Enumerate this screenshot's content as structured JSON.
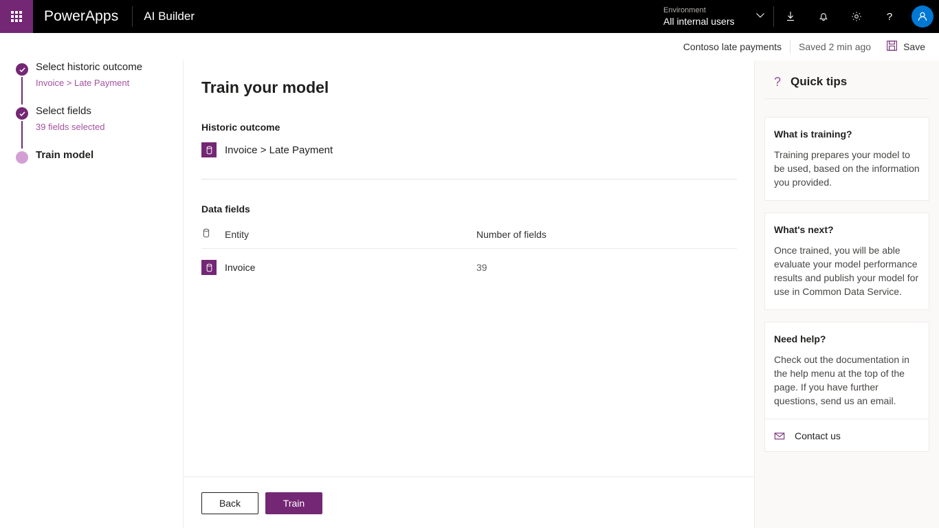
{
  "header": {
    "waffle_label": "app-launcher",
    "brand": "PowerApps",
    "app_name": "AI Builder",
    "environment_label": "Environment",
    "environment_value": "All internal users",
    "icons": [
      "download-icon",
      "bell-icon",
      "gear-icon",
      "help-icon",
      "avatar"
    ]
  },
  "command_bar": {
    "model_name": "Contoso late payments",
    "saved_status": "Saved 2 min ago",
    "save_label": "Save"
  },
  "wizard": {
    "steps": [
      {
        "title": "Select historic outcome",
        "sub": "Invoice > Late Payment",
        "state": "done"
      },
      {
        "title": "Select fields",
        "sub": "39 fields selected",
        "state": "done"
      },
      {
        "title": "Train model",
        "sub": "",
        "state": "current"
      }
    ]
  },
  "main": {
    "page_title": "Train your model",
    "historic_outcome_label": "Historic outcome",
    "historic_outcome_value": "Invoice > Late Payment",
    "data_fields_label": "Data fields",
    "table": {
      "columns": [
        "",
        "Entity",
        "Number of fields"
      ],
      "rows": [
        {
          "entity": "Invoice",
          "fields": "39"
        }
      ]
    }
  },
  "footer": {
    "back_label": "Back",
    "train_label": "Train"
  },
  "tips": {
    "title": "Quick tips",
    "cards": [
      {
        "head": "What is training?",
        "body": "Training prepares your model to be used, based on the information you provided."
      },
      {
        "head": "What's next?",
        "body": "Once trained, you will be able evaluate your model performance results and publish your model for use in Common Data Service."
      },
      {
        "head": "Need help?",
        "body": "Check out the documentation in the help menu at the top of the page. If you have further questions, send us an email.",
        "link": "Contact us"
      }
    ]
  },
  "colors": {
    "brand_purple": "#742774",
    "accent_link": "#a4519f",
    "avatar_blue": "#0078d4",
    "header_black": "#000000",
    "pane_bg": "#faf9f8"
  }
}
